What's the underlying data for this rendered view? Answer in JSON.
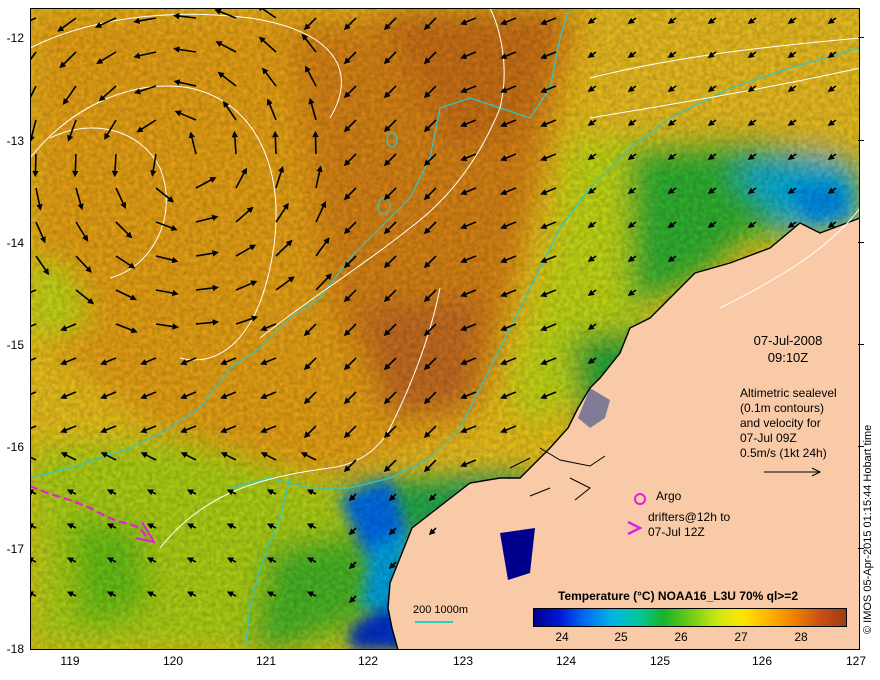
{
  "map": {
    "lat_ticks": [
      "-12",
      "-13",
      "-14",
      "-15",
      "-16",
      "-17",
      "-18"
    ],
    "lon_ticks": [
      "119",
      "120",
      "121",
      "122",
      "123",
      "124",
      "125",
      "126",
      "127"
    ],
    "date": "07-Jul-2008",
    "time": "09:10Z",
    "altimetry_lines": [
      "Altimetric sealevel",
      "(0.1m contours)",
      "and velocity for",
      "07-Jul 09Z",
      "0.5m/s (1kt 24h)"
    ],
    "argo_label": "Argo",
    "drifters_line1": "drifters@12h to",
    "drifters_line2": "07-Jul 12Z",
    "depth_legend": "200  1000m",
    "credit": "© IMOS 05-Apr-2015 01:15:44 Hobart time",
    "colors": {
      "land": "#f9caa7",
      "bathymetry_contour": "#2fc8c8",
      "sea_level_contour": "#ffffff",
      "argo": "#e020e0",
      "drifter": "#e020e0"
    }
  },
  "colorbar": {
    "title": "Temperature (°C) NOAA16_L3U 70% ql>=2",
    "ticks": [
      "24",
      "25",
      "26",
      "27",
      "28"
    ],
    "range": [
      23.5,
      28.7
    ],
    "stops": [
      "#00008c",
      "#0018d8",
      "#0070f0",
      "#00b4e6",
      "#00c8a0",
      "#18b428",
      "#6ccc14",
      "#c8e614",
      "#ffe600",
      "#ffb400",
      "#f08200",
      "#c85014",
      "#a03a14"
    ]
  }
}
